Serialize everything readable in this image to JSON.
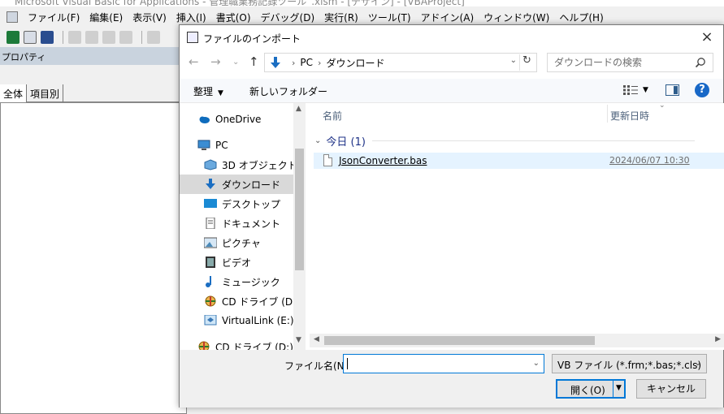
{
  "vba": {
    "title": "Microsoft Visual Basic for Applications - 管理職業務記録ツール_.xlsm - [デザイン] - [VBAProject]",
    "menu": [
      "ファイル(F)",
      "編集(E)",
      "表示(V)",
      "挿入(I)",
      "書式(O)",
      "デバッグ(D)",
      "実行(R)",
      "ツール(T)",
      "アドイン(A)",
      "ウィンドウ(W)",
      "ヘルプ(H)"
    ],
    "properties_title": "プロパティ",
    "tabs": [
      "全体",
      "項目別"
    ]
  },
  "dialog": {
    "title": "ファイルのインポート",
    "close": "×",
    "breadcrumb": [
      "PC",
      "ダウンロード"
    ],
    "search_placeholder": "ダウンロードの検索",
    "organize": "整理",
    "new_folder": "新しいフォルダー",
    "nav_items": [
      {
        "label": "OneDrive",
        "icon": "cloud-icon"
      },
      {
        "label": "PC",
        "icon": "pc-icon"
      },
      {
        "label": "3D オブジェクト",
        "icon": "3d-objects-icon"
      },
      {
        "label": "ダウンロード",
        "icon": "download-icon"
      },
      {
        "label": "デスクトップ",
        "icon": "desktop-icon"
      },
      {
        "label": "ドキュメント",
        "icon": "document-icon"
      },
      {
        "label": "ピクチャ",
        "icon": "pictures-icon"
      },
      {
        "label": "ビデオ",
        "icon": "video-icon"
      },
      {
        "label": "ミュージック",
        "icon": "music-icon"
      },
      {
        "label": "CD ドライブ (D:) M",
        "icon": "cd-drive-icon"
      },
      {
        "label": "VirtualLink (E:)",
        "icon": "network-drive-icon"
      },
      {
        "label": "CD ドライブ (D:) Ma",
        "icon": "cd-drive-icon"
      }
    ],
    "selected_nav": "ダウンロード",
    "columns": {
      "name": "名前",
      "date": "更新日時"
    },
    "group": "今日 (1)",
    "files": [
      {
        "name": "JsonConverter.bas",
        "date": "2024/06/07 10:30"
      }
    ],
    "filename_label": "ファイル名(N):",
    "filename_value": "",
    "filetype": "VB ファイル (*.frm;*.bas;*.cls)",
    "open_button": "開く(O)",
    "cancel_button": "キャンセル"
  },
  "colors": {
    "accent": "#0078d7",
    "selection": "#e5f3ff",
    "help": "#1868c7",
    "group_header": "#1e3287"
  }
}
